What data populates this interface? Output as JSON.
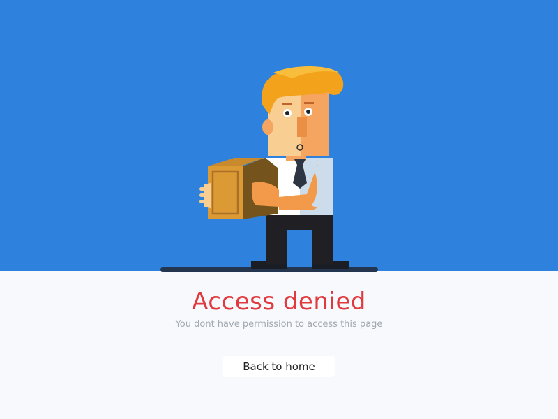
{
  "error": {
    "title": "Access denied",
    "message": "You dont have permission to access this page",
    "back_button_label": "Back to home"
  },
  "colors": {
    "hero_background": "#2e82de",
    "page_background": "#f7f9fc",
    "title": "#e0393e",
    "message": "#a3a9b0",
    "button_background": "#ffffff"
  },
  "illustration": {
    "subject": "man-holding-box",
    "icons": [
      "man-character-icon",
      "cardboard-box-icon",
      "tie-icon"
    ]
  }
}
